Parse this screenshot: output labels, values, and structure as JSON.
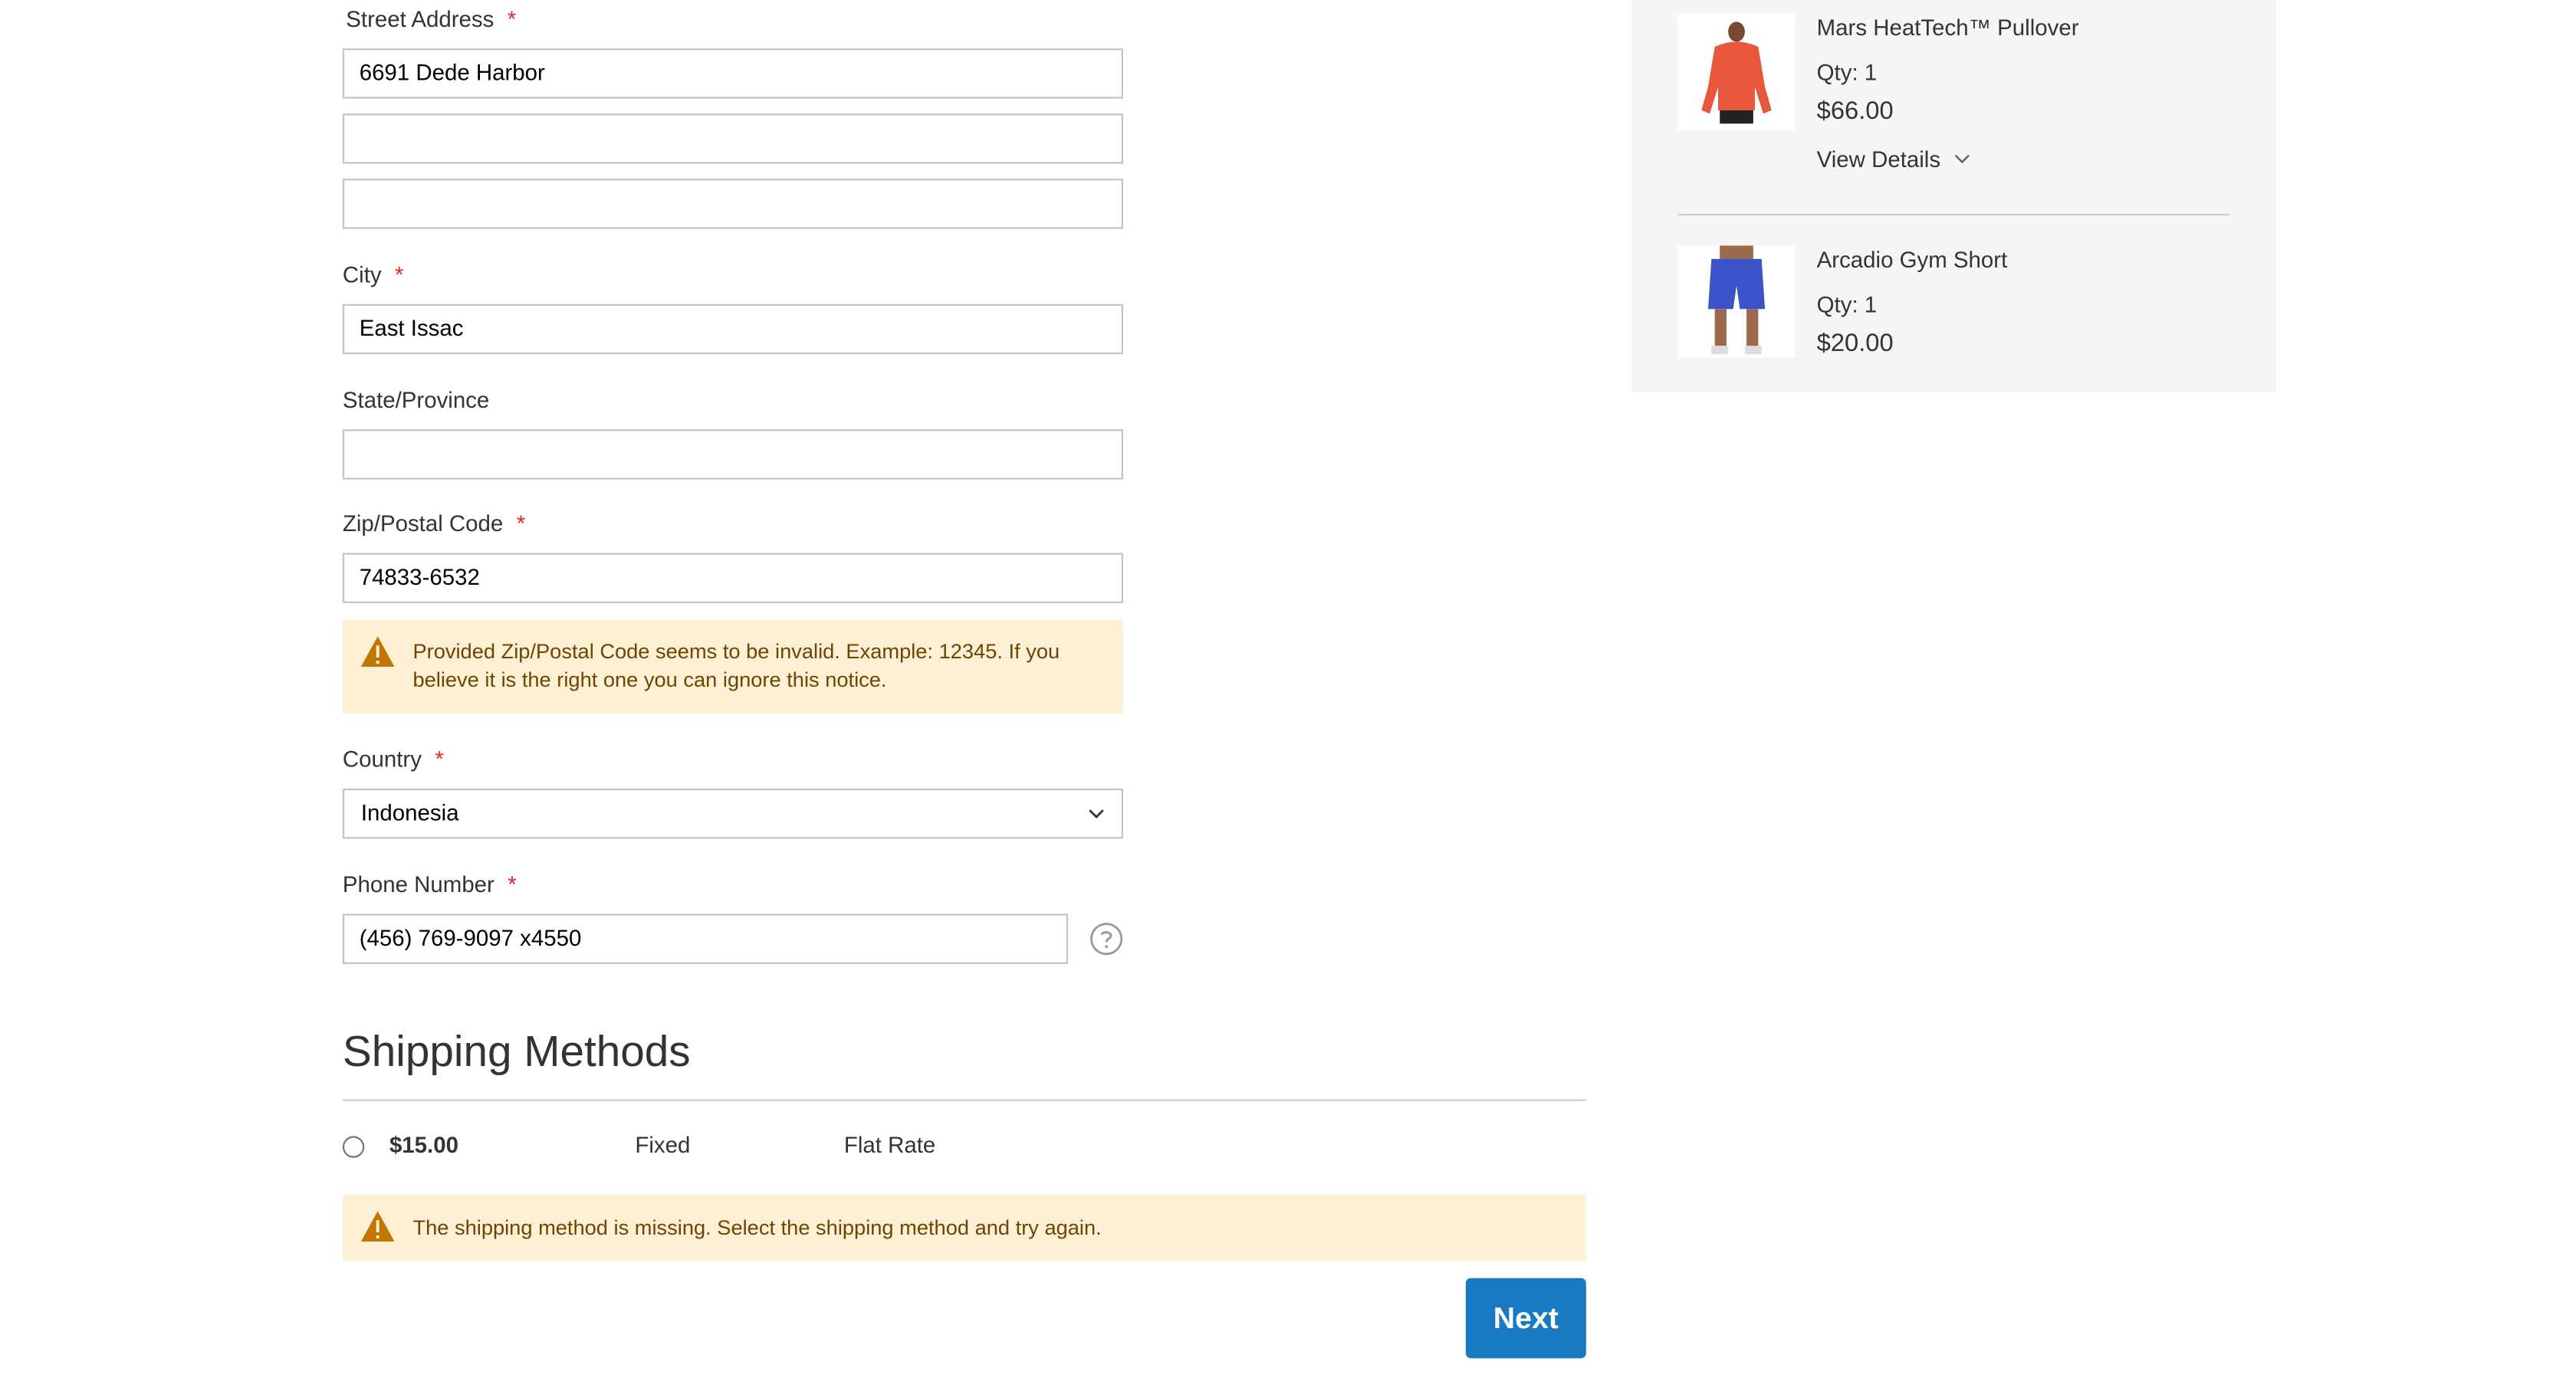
{
  "address": {
    "street_label": "Street Address",
    "street_line1": "6691 Dede Harbor",
    "street_line2": "",
    "street_line3": "",
    "city_label": "City",
    "city_value": "East Issac",
    "state_label": "State/Province",
    "state_value": "",
    "zip_label": "Zip/Postal Code",
    "zip_value": "74833-6532",
    "zip_notice": "Provided Zip/Postal Code seems to be invalid. Example: 12345. If you believe it is the right one you can ignore this notice.",
    "country_label": "Country",
    "country_value": "Indonesia",
    "phone_label": "Phone Number",
    "phone_value": "(456) 769-9097 x4550",
    "required_mark": "*"
  },
  "shipping": {
    "title": "Shipping Methods",
    "method_price": "$15.00",
    "method_type": "Fixed",
    "method_carrier": "Flat Rate",
    "missing_notice": "The shipping method is missing. Select the shipping method and try again.",
    "next_label": "Next"
  },
  "summary": {
    "items": [
      {
        "name": "Mars HeatTech™ Pullover",
        "qty": "Qty: 1",
        "price": "$66.00",
        "details_label": "View Details"
      },
      {
        "name": "Arcadio Gym Short",
        "qty": "Qty: 1",
        "price": "$20.00"
      }
    ]
  },
  "colors": {
    "accent": "#1979c3",
    "notice_bg": "#fdf0d5",
    "notice_text": "#6f4400",
    "required": "#e02b27",
    "summary_bg": "#f5f5f5"
  },
  "icons": {
    "warning": "warning-icon",
    "help": "help-icon",
    "chevron": "chevron-down-icon"
  }
}
